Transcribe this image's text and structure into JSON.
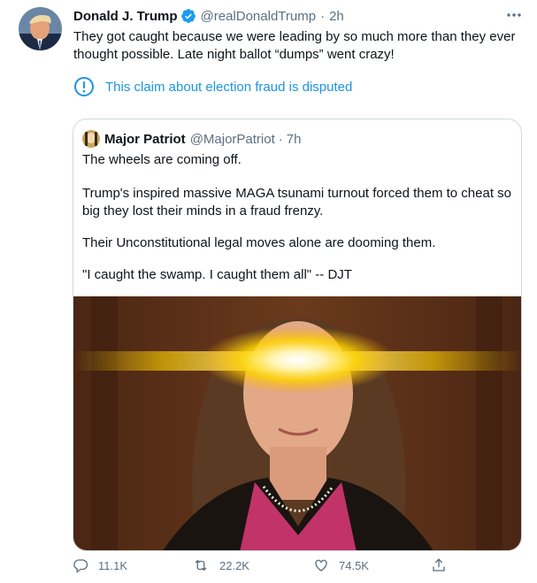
{
  "tweet": {
    "author_name": "Donald J. Trump",
    "handle": "@realDonaldTrump",
    "separator": "·",
    "time": "2h",
    "text": "They got caught because we were leading by so much more than they ever thought possible. Late night ballot “dumps” went crazy!",
    "label": "This claim about election fraud is disputed"
  },
  "quote": {
    "author_name": "Major Patriot",
    "handle": "@MajorPatriot",
    "separator": "·",
    "time": "7h",
    "paragraphs": [
      "The wheels are coming off.",
      "Trump's inspired massive MAGA tsunami turnout forced them to cheat so big they lost their minds in a fraud frenzy.",
      "Their Unconstitutional legal moves alone are dooming them.",
      "\"I caught the swamp. I caught them all\" -- DJT"
    ]
  },
  "actions": {
    "reply_count": "11.1K",
    "retweet_count": "22.2K",
    "like_count": "74.5K"
  },
  "colors": {
    "accent": "#1b95e0",
    "secondary_text": "#5b7083",
    "border": "#cfd9de"
  },
  "icons": [
    "verified-badge-icon",
    "more-icon",
    "info-circle-icon",
    "reply-icon",
    "retweet-icon",
    "like-icon",
    "share-icon"
  ]
}
